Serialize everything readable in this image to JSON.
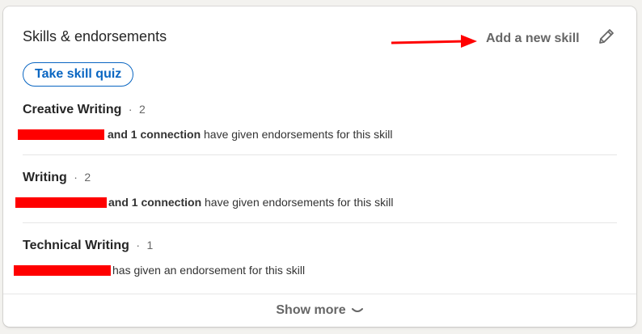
{
  "section": {
    "title": "Skills & endorsements",
    "add_skill_label": "Add a new skill",
    "quiz_label": "Take skill quiz",
    "show_more_label": "Show more",
    "accent_color": "#0a66c2",
    "annotation_arrow_color": "#ff0000"
  },
  "skills": [
    {
      "name": "Creative Writing",
      "separator": "·",
      "count": "2",
      "endorsed_bold": "and 1 connection",
      "endorsed_text": " have given endorsements for this skill"
    },
    {
      "name": "Writing",
      "separator": "·",
      "count": "2",
      "endorsed_bold": "and 1 connection",
      "endorsed_text": " have given endorsements for this skill"
    },
    {
      "name": "Technical Writing",
      "separator": "·",
      "count": "1",
      "endorsed_bold": "",
      "endorsed_text": "has given an endorsement for this skill"
    }
  ],
  "icons": {
    "edit": "pencil-icon",
    "chevron": "chevron-down-icon",
    "arrow": "red-arrow-annotation"
  }
}
